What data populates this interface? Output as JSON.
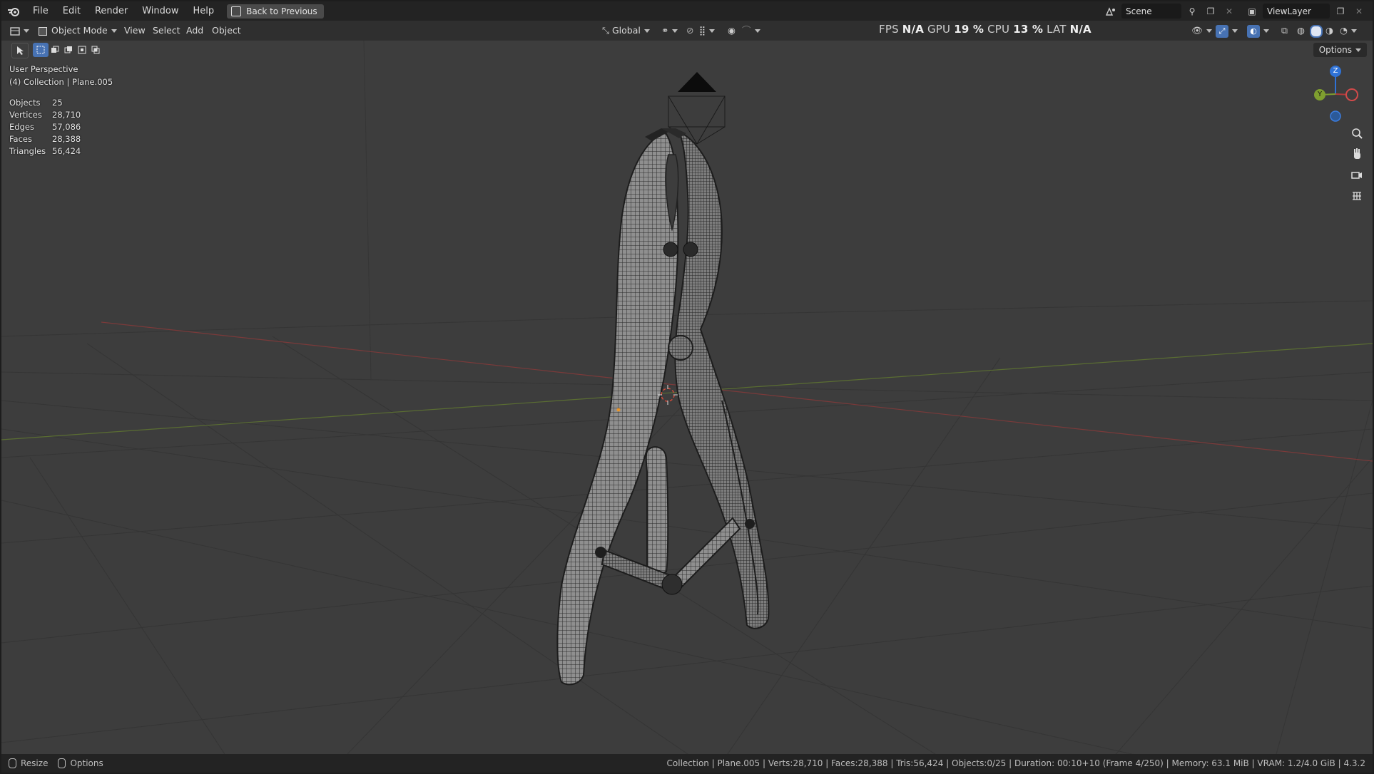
{
  "menu": {
    "items": [
      "File",
      "Edit",
      "Render",
      "Window",
      "Help"
    ],
    "back_button": "Back to Previous"
  },
  "top_right": {
    "scene_name": "Scene",
    "view_layer": "ViewLayer"
  },
  "header": {
    "mode": "Object Mode",
    "menus": [
      "View",
      "Select",
      "Add",
      "Object"
    ],
    "transform_orientation": "Global"
  },
  "perf": {
    "fps_label": "FPS",
    "fps_value": "N/A",
    "gpu_label": "GPU",
    "gpu_value": "19 %",
    "cpu_label": "CPU",
    "cpu_value": "13 %",
    "lat_label": "LAT",
    "lat_value": "N/A"
  },
  "viewport": {
    "view_name": "User Perspective",
    "context": "(4) Collection | Plane.005",
    "options_label": "Options",
    "stats": [
      {
        "label": "Objects",
        "value": "25"
      },
      {
        "label": "Vertices",
        "value": "28,710"
      },
      {
        "label": "Edges",
        "value": "57,086"
      },
      {
        "label": "Faces",
        "value": "28,388"
      },
      {
        "label": "Triangles",
        "value": "56,424"
      }
    ],
    "gizmo": {
      "z": "Z",
      "y": "Y"
    }
  },
  "statusbar": {
    "resize": "Resize",
    "options": "Options",
    "info": "Collection | Plane.005 | Verts:28,710 | Faces:28,388 | Tris:56,424 | Objects:0/25 | Duration: 00:10+10 (Frame 4/250) | Memory: 63.1 MiB | VRAM: 1.2/4.0 GiB | 4.3.2"
  },
  "colors": {
    "accent": "#4772b3",
    "x_axis": "#b53b3b",
    "y_axis": "#7f9f2f",
    "z_axis": "#2f72d6"
  }
}
